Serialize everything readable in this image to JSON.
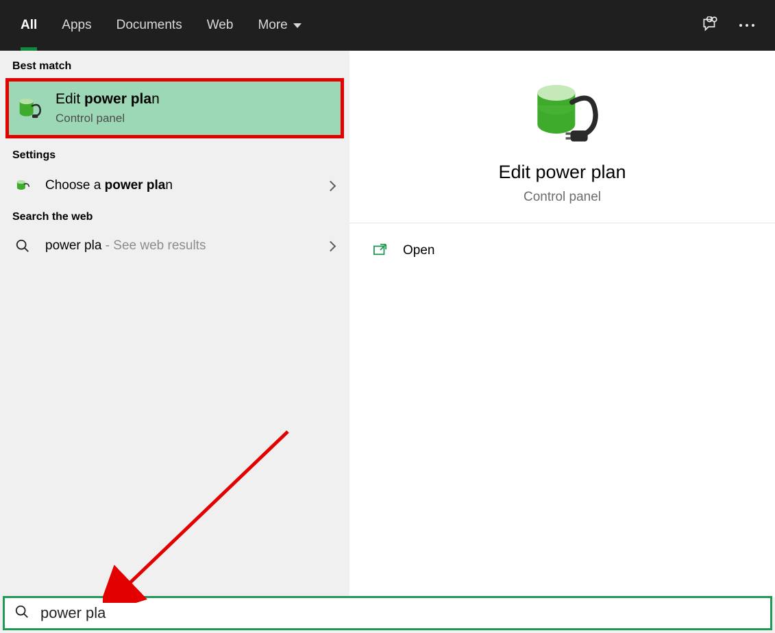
{
  "topbar": {
    "tabs": {
      "all": "All",
      "apps": "Apps",
      "documents": "Documents",
      "web": "Web",
      "more": "More"
    }
  },
  "sections": {
    "best_match": "Best match",
    "settings": "Settings",
    "search_web": "Search the web"
  },
  "best_match": {
    "title_pre": "Edit ",
    "title_bold": "power pla",
    "title_post": "n",
    "subtitle": "Control panel"
  },
  "settings_row": {
    "pre": "Choose a ",
    "bold": "power pla",
    "post": "n"
  },
  "web_row": {
    "query": "power pla",
    "suffix": " - See web results"
  },
  "detail": {
    "title": "Edit power plan",
    "subtitle": "Control panel",
    "open_label": "Open"
  },
  "search": {
    "value": "power pla"
  }
}
